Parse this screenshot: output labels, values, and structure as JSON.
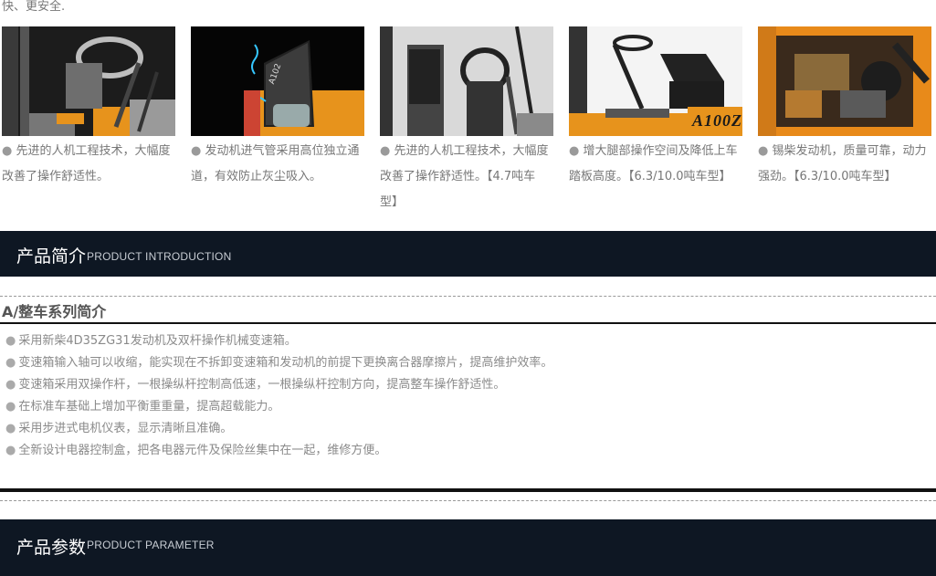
{
  "top_text": "快、更安全.",
  "gallery": [
    {
      "caption": "先进的人机工程技术，大幅度改善了操作舒适性。",
      "image": "operator-cab-photo"
    },
    {
      "caption": "发动机进气管采用高位独立通道，有效防止灰尘吸入。",
      "image": "engine-air-intake-photo"
    },
    {
      "caption": "先进的人机工程技术，大幅度改善了操作舒适性。【4.7吨车型】",
      "image": "steering-controls-photo"
    },
    {
      "caption": "增大腿部操作空间及降低上车踏板高度。【6.3/10.0吨车型】",
      "image": "seat-step-photo",
      "badge": "A100Z"
    },
    {
      "caption": "锡柴发动机，质量可靠，动力强劲。【6.3/10.0吨车型】",
      "image": "engine-bay-photo"
    }
  ],
  "bullet": "●",
  "intro_section": {
    "title_zh": "产品简介",
    "title_en": "PRODUCT INTRODUCTION"
  },
  "series_heading": "A/整车系列简介",
  "features": [
    "采用新柴4D35ZG31发动机及双杆操作机械变速箱。",
    "变速箱输入轴可以收缩，能实现在不拆卸变速箱和发动机的前提下更换离合器摩擦片，提高维护效率。",
    "变速箱采用双操作杆，一根操纵杆控制高低速，一根操纵杆控制方向，提高整车操作舒适性。",
    "在标准车基础上增加平衡重重量，提高超载能力。",
    "采用步进式电机仪表，显示清晰且准确。",
    "全新设计电器控制盒，把各电器元件及保险丝集中在一起，维修方便。"
  ],
  "param_section": {
    "title_zh": "产品参数",
    "title_en": "PRODUCT PARAMETER"
  },
  "colors": {
    "banner_bg": "#0e1723",
    "forklift_orange": "#e7931c",
    "divider": "#111111"
  }
}
